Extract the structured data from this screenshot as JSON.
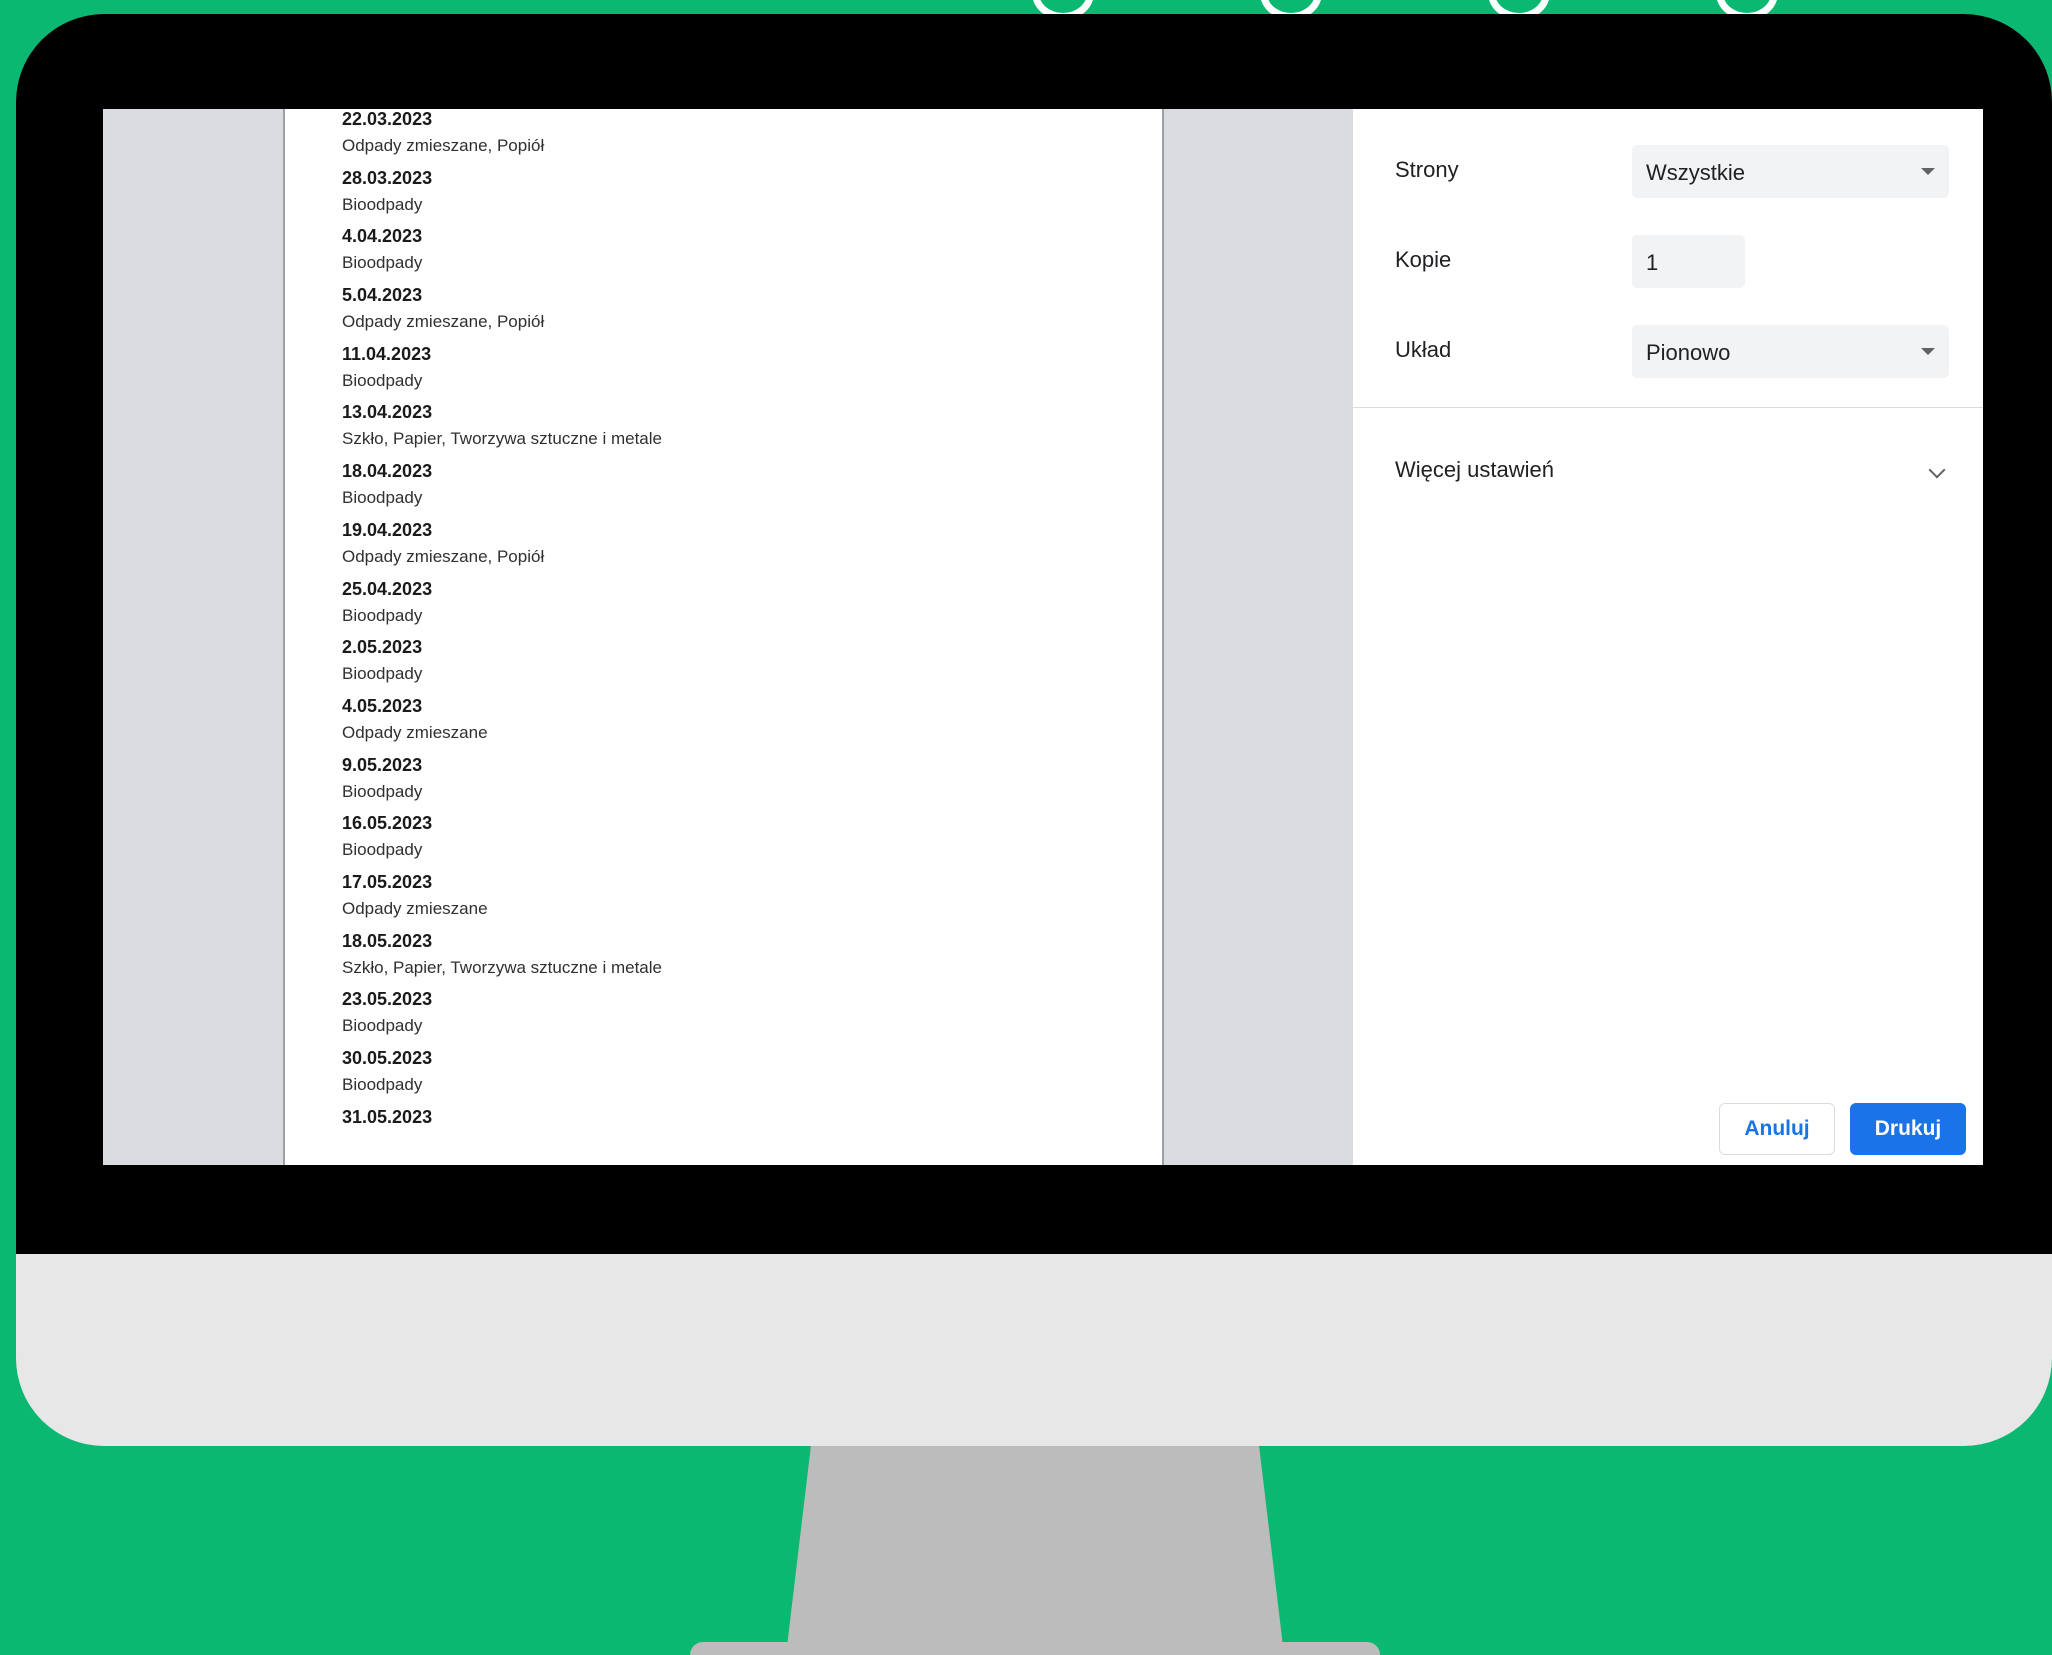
{
  "preview": {
    "entries": [
      {
        "date": "22.03.2023",
        "kind": "Odpady zmieszane, Popiół"
      },
      {
        "date": "28.03.2023",
        "kind": "Bioodpady"
      },
      {
        "date": "4.04.2023",
        "kind": "Bioodpady"
      },
      {
        "date": "5.04.2023",
        "kind": "Odpady zmieszane, Popiół"
      },
      {
        "date": "11.04.2023",
        "kind": "Bioodpady"
      },
      {
        "date": "13.04.2023",
        "kind": "Szkło, Papier, Tworzywa sztuczne i metale"
      },
      {
        "date": "18.04.2023",
        "kind": "Bioodpady"
      },
      {
        "date": "19.04.2023",
        "kind": "Odpady zmieszane, Popiół"
      },
      {
        "date": "25.04.2023",
        "kind": "Bioodpady"
      },
      {
        "date": "2.05.2023",
        "kind": "Bioodpady"
      },
      {
        "date": "4.05.2023",
        "kind": "Odpady zmieszane"
      },
      {
        "date": "9.05.2023",
        "kind": "Bioodpady"
      },
      {
        "date": "16.05.2023",
        "kind": "Bioodpady"
      },
      {
        "date": "17.05.2023",
        "kind": "Odpady zmieszane"
      },
      {
        "date": "18.05.2023",
        "kind": "Szkło, Papier, Tworzywa sztuczne i metale"
      },
      {
        "date": "23.05.2023",
        "kind": "Bioodpady"
      },
      {
        "date": "30.05.2023",
        "kind": "Bioodpady"
      },
      {
        "date": "31.05.2023",
        "kind": ""
      }
    ]
  },
  "settings": {
    "pages_label": "Strony",
    "pages_value": "Wszystkie",
    "copies_label": "Kopie",
    "copies_value": "1",
    "layout_label": "Układ",
    "layout_value": "Pionowo",
    "more_settings_label": "Więcej ustawień",
    "cancel_label": "Anuluj",
    "print_label": "Drukuj"
  },
  "colors": {
    "background": "#0bb871",
    "accent": "#1a73e8"
  }
}
